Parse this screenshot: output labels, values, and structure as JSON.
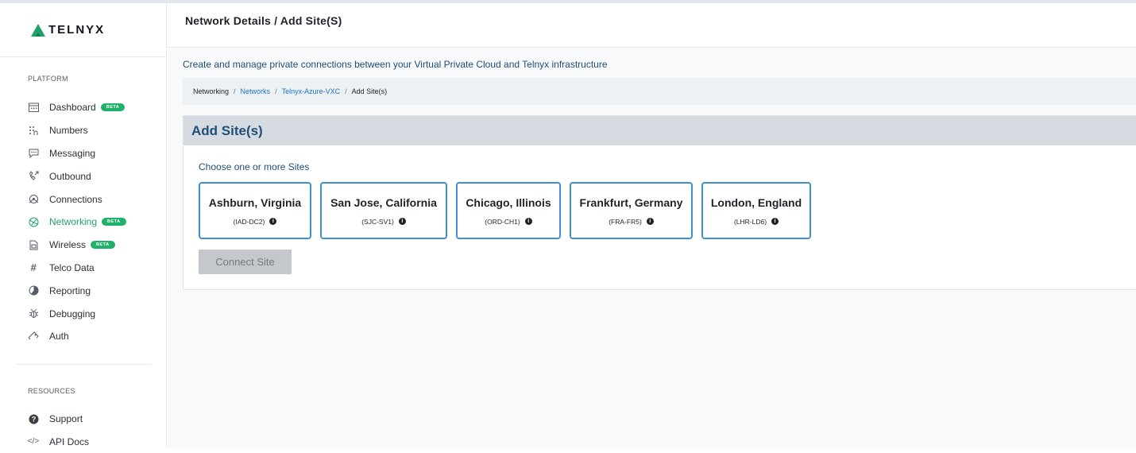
{
  "brand": {
    "name": "TELNYX",
    "color": "#1da36a"
  },
  "sidebar": {
    "platform_label": "PLATFORM",
    "items": [
      {
        "label": "Dashboard",
        "icon": "calendar-icon",
        "badge": "BETA",
        "active": false
      },
      {
        "label": "Numbers",
        "icon": "dialpad-icon",
        "badge": null,
        "active": false
      },
      {
        "label": "Messaging",
        "icon": "chat-bubble-icon",
        "badge": null,
        "active": false
      },
      {
        "label": "Outbound",
        "icon": "phone-outgoing-icon",
        "badge": null,
        "active": false
      },
      {
        "label": "Connections",
        "icon": "network-nodes-icon",
        "badge": null,
        "active": false
      },
      {
        "label": "Networking",
        "icon": "globe-network-icon",
        "badge": "BETA",
        "active": true
      },
      {
        "label": "Wireless",
        "icon": "sim-card-icon",
        "badge": "BETA",
        "active": false
      },
      {
        "label": "Telco Data",
        "icon": "hash-icon",
        "badge": null,
        "active": false
      },
      {
        "label": "Reporting",
        "icon": "pie-chart-icon",
        "badge": null,
        "active": false
      },
      {
        "label": "Debugging",
        "icon": "bug-icon",
        "badge": null,
        "active": false
      },
      {
        "label": "Auth",
        "icon": "key-icon",
        "badge": null,
        "active": false
      }
    ],
    "resources_label": "RESOURCES",
    "resources": [
      {
        "label": "Support",
        "icon": "help-circle-icon"
      },
      {
        "label": "API Docs",
        "icon": "code-icon"
      }
    ]
  },
  "header": {
    "title": "Network Details / Add Site(S)"
  },
  "description": "Create and manage private connections between your Virtual Private Cloud and Telnyx infrastructure",
  "breadcrumb": {
    "items": [
      "Networking",
      "Networks",
      "Telnyx-Azure-VXC",
      "Add Site(s)"
    ],
    "separator": "/"
  },
  "panel": {
    "title": "Add Site(s)",
    "choose_label": "Choose one or more Sites",
    "sites": [
      {
        "name": "Ashburn, Virginia",
        "code": "(IAD-DC2)"
      },
      {
        "name": "San Jose, California",
        "code": "(SJC-SV1)"
      },
      {
        "name": "Chicago, Illinois",
        "code": "(ORD-CH1)"
      },
      {
        "name": "Frankfurt, Germany",
        "code": "(FRA-FR5)"
      },
      {
        "name": "London, England",
        "code": "(LHR-LD6)"
      }
    ],
    "connect_label": "Connect Site"
  },
  "colors": {
    "accent_green": "#1da36a",
    "link_blue": "#1a73c9",
    "title_navy": "#1f4e79",
    "card_border": "#3d8fd6",
    "disabled_button": "#c4c7cb"
  }
}
